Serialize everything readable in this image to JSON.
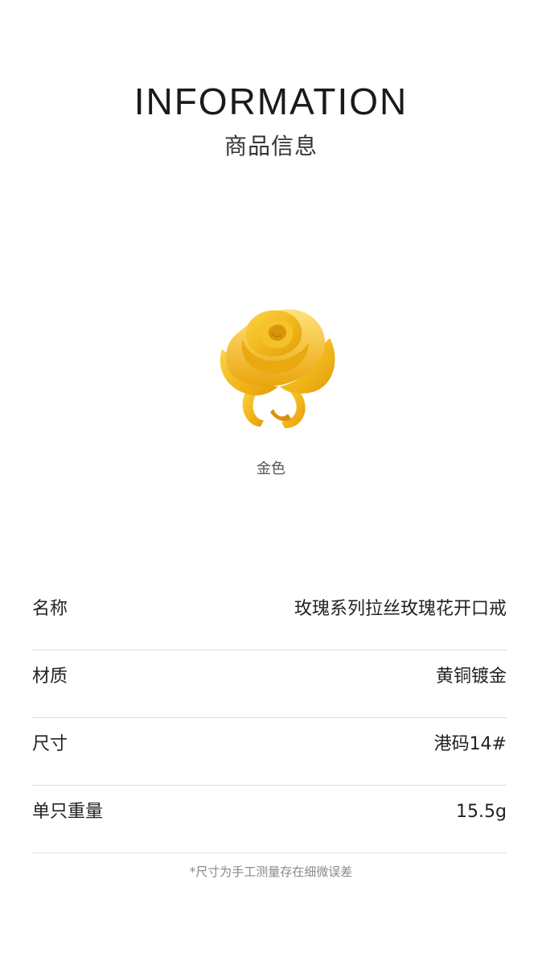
{
  "header": {
    "title_en": "INFORMATION",
    "title_cn": "商品信息"
  },
  "product": {
    "image_icon": "gold-rose-ring-image",
    "color_label": "金色",
    "accent_color": "#f2b91c"
  },
  "specs": [
    {
      "key": "名称",
      "value": "玫瑰系列拉丝玫瑰花开口戒"
    },
    {
      "key": "材质",
      "value": "黄铜镀金"
    },
    {
      "key": "尺寸",
      "value": "港码14#"
    },
    {
      "key": "单只重量",
      "value": "15.5g"
    }
  ],
  "footnote": "*尺寸为手工测量存在细微误差"
}
